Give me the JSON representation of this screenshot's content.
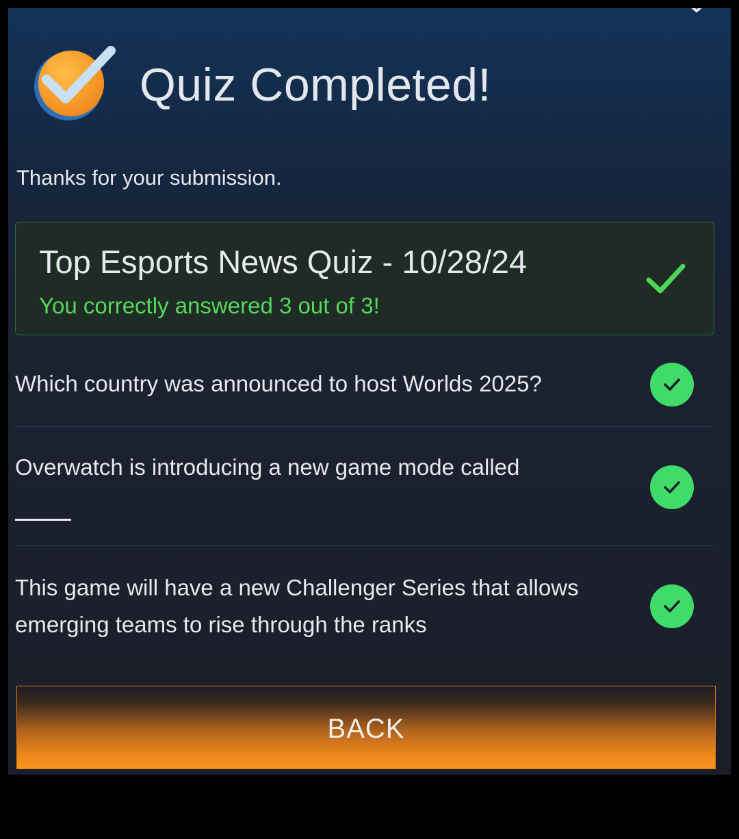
{
  "dialog": {
    "title": "Quiz Completed!",
    "subtitle": "Thanks for your submission.",
    "icons": {
      "badge": "checkmark-badge-icon",
      "close": "close-icon"
    }
  },
  "result": {
    "title": "Top Esports News Quiz - 10/28/24",
    "score_text": "You correctly answered 3 out of 3!",
    "status_icon": "checkmark-icon"
  },
  "questions": [
    {
      "text": "Which country was announced to host Worlds 2025?",
      "status": "correct"
    },
    {
      "text": "Overwatch is introducing a new game mode called",
      "status": "correct"
    },
    {
      "text": "This game will have a new Challenger Series that allows emerging teams to rise through the ranks",
      "status": "correct"
    }
  ],
  "actions": {
    "back_label": "BACK"
  },
  "colors": {
    "accent_orange": "#f7931e",
    "success_green": "#3fdc6a",
    "score_green": "#56d85a",
    "panel_bg": "#1b1e28"
  }
}
